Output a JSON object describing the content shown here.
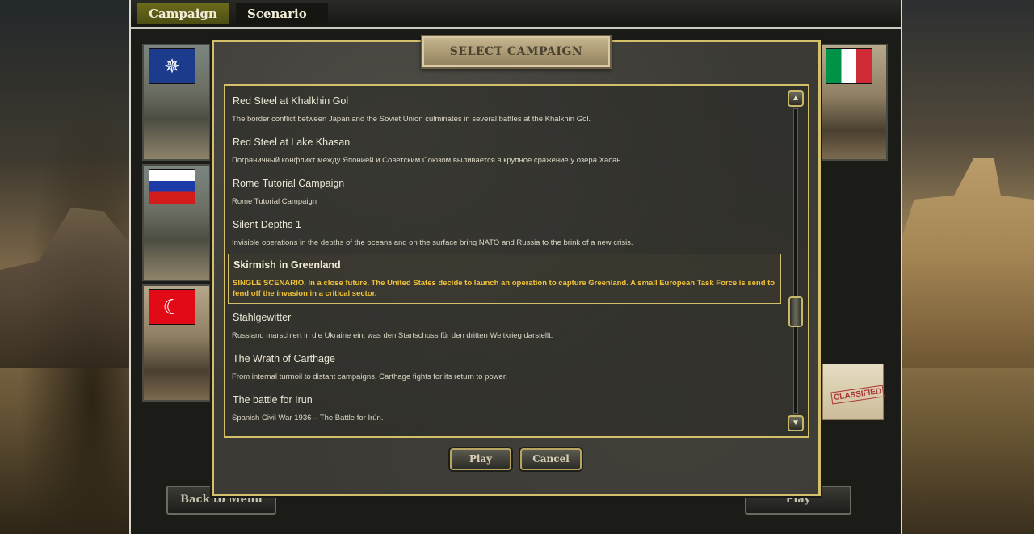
{
  "tabs": {
    "campaign": "Campaign",
    "scenario": "Scenario"
  },
  "dialog": {
    "title": "SELECT CAMPAIGN",
    "play_label": "Play",
    "cancel_label": "Cancel"
  },
  "background_buttons": {
    "back_to_menu": "Back to Menu",
    "play": "Play"
  },
  "folder_stamp": "CLASSIFIED",
  "flags": [
    "nato-flag",
    "russia-flag",
    "turkey-flag",
    "italy-flag"
  ],
  "campaigns": [
    {
      "title": "Red Steel at Khalkhin Gol",
      "description": "The border conflict between Japan and the Soviet Union culminates in several battles at the Khalkhin Gol."
    },
    {
      "title": "Red Steel at Lake Khasan",
      "description": "Пограничный конфликт между Японией и Советским Союзом выливается в крупное сражение у озера Хасан."
    },
    {
      "title": "Rome Tutorial Campaign",
      "description": "Rome Tutorial Campaign"
    },
    {
      "title": "Silent Depths 1",
      "description": "Invisible operations in the depths of the oceans and on the surface bring NATO and Russia to the brink of a new crisis."
    },
    {
      "title": "Skirmish in Greenland",
      "description": "SINGLE SCENARIO. In a close future, The United States decide to launch an operation to capture Greenland. A small European Task Force is send to fend off the invasion in a critical sector.",
      "selected": true
    },
    {
      "title": "Stahlgewitter",
      "description": "Russland marschiert in die Ukraine ein, was den Startschuss für den dritten Weltkrieg darstellt."
    },
    {
      "title": "The Wrath of Carthage",
      "description": "From internal turmoil to distant campaigns, Carthage fights for its return to power."
    },
    {
      "title": "The battle for Irun",
      "description": "Spanish Civil War 1936 – The Battle for Irún."
    }
  ],
  "colors": {
    "accent_gold": "#d4c06a",
    "selected_text": "#f0c23a",
    "tab_active": "#5c5d18"
  }
}
